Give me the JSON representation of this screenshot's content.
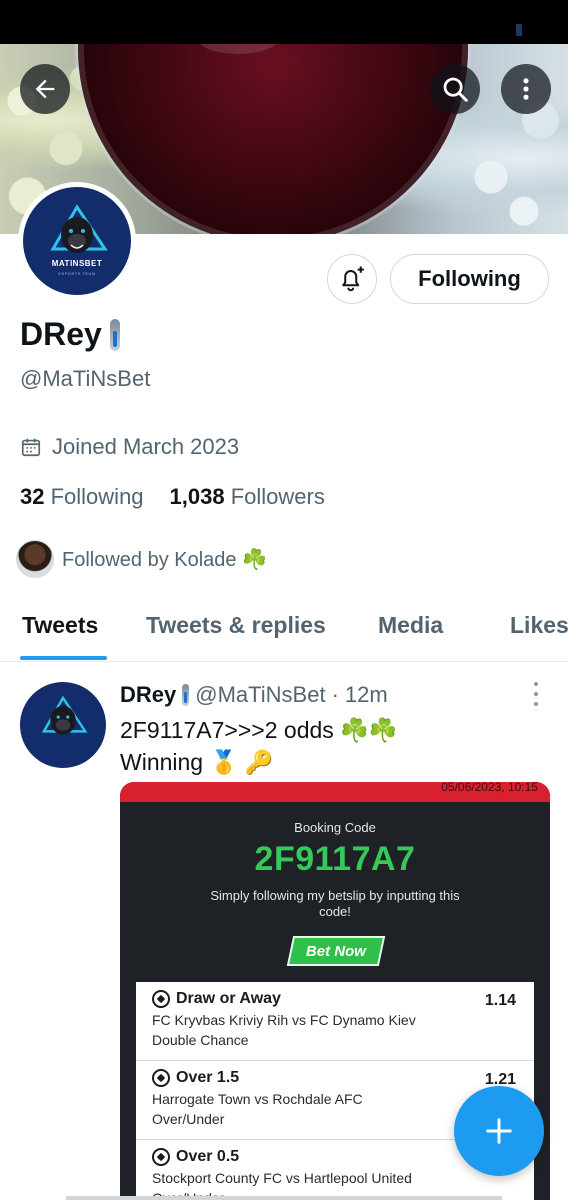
{
  "profile": {
    "display_name": "DRey",
    "handle": "@MaTiNsBet",
    "joined": "Joined March 2023",
    "following_count": "32",
    "following_label": "Following",
    "followers_count": "1,038",
    "followers_label": "Followers",
    "followed_by": "Followed by Kolade ☘️",
    "avatar_logo_text": "MATINSBET",
    "avatar_logo_sub": "ESPORTS TEAM"
  },
  "actions": {
    "following_button": "Following",
    "notify_icon": "bell-plus-icon",
    "back_icon": "arrow-left-icon",
    "search_icon": "search-icon",
    "more_icon": "more-vertical-icon"
  },
  "tabs": [
    {
      "label": "Tweets",
      "active": true
    },
    {
      "label": "Tweets & replies",
      "active": false
    },
    {
      "label": "Media",
      "active": false
    },
    {
      "label": "Likes",
      "active": false
    }
  ],
  "tweet": {
    "name": "DRey",
    "handle": "@MaTiNsBet",
    "time": "12m",
    "line1": "2F9117A7>>>2 odds ☘️☘️",
    "line2": "Winning 🥇 🔑",
    "slip": {
      "date": "05/06/2023, 10:15",
      "booking_label": "Booking Code",
      "code": "2F9117A7",
      "description": "Simply following my betslip by inputting this code!",
      "bet_now": "Bet Now",
      "picks": [
        {
          "title": "Draw or Away",
          "odds": "1.14",
          "match": "FC Kryvbas Kriviy Rih vs FC Dynamo Kiev",
          "market": "Double Chance"
        },
        {
          "title": "Over 1.5",
          "odds": "1.21",
          "match": "Harrogate Town vs Rochdale AFC",
          "market": "Over/Under"
        },
        {
          "title": "Over 0.5",
          "odds": "",
          "match": "Stockport County FC vs Hartlepool United",
          "market": "Over/Under"
        }
      ]
    }
  },
  "colors": {
    "accent": "#1d9bf0",
    "slip_green": "#37c85a",
    "slip_red": "#d9202f"
  }
}
